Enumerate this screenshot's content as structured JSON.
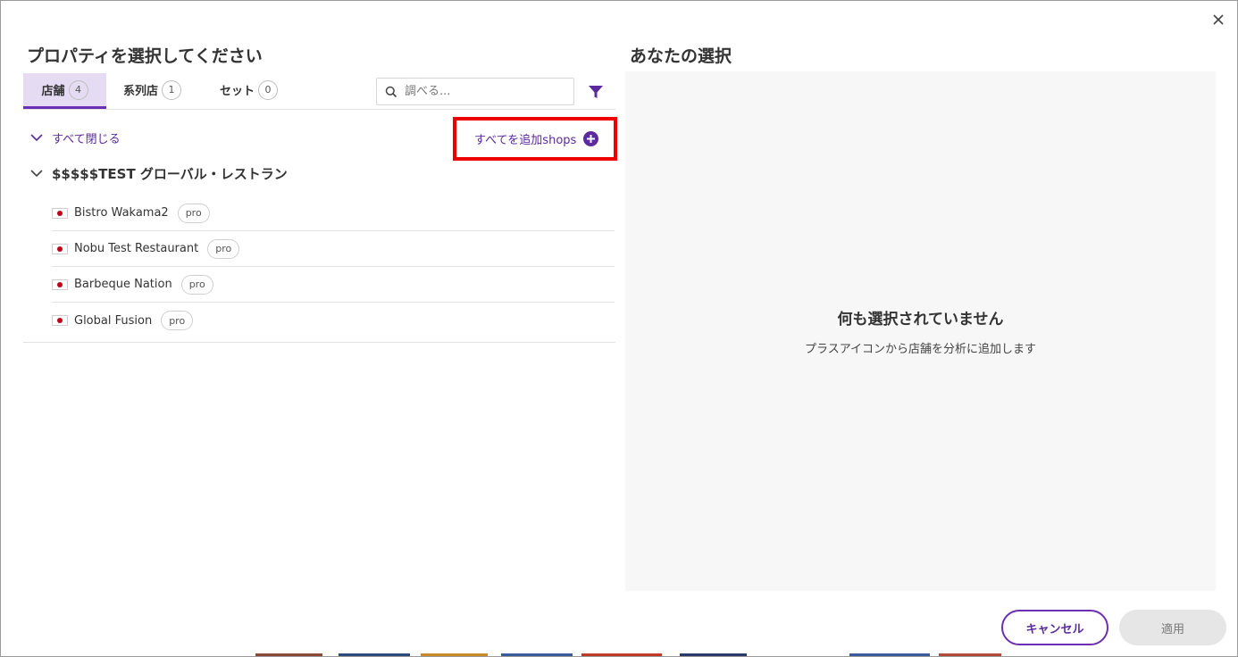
{
  "left": {
    "title": "プロパティを選択してください",
    "tabs": [
      {
        "label": "店舗",
        "count": "4",
        "active": true
      },
      {
        "label": "系列店",
        "count": "1",
        "active": false
      },
      {
        "label": "セット",
        "count": "0",
        "active": false
      }
    ],
    "search": {
      "placeholder": "調べる...",
      "value": ""
    },
    "collapse_all_label": "すべて閉じる",
    "add_all_label": "すべてを追加shops",
    "group": {
      "name": "$$$$$TEST グローバル・レストラン",
      "shops": [
        {
          "name": "Bistro Wakama2",
          "badge": "pro"
        },
        {
          "name": "Nobu Test Restaurant",
          "badge": "pro"
        },
        {
          "name": "Barbeque Nation",
          "badge": "pro"
        },
        {
          "name": "Global Fusion",
          "badge": "pro"
        }
      ]
    }
  },
  "right": {
    "title": "あなたの選択",
    "empty_title": "何も選択されていません",
    "empty_desc": "プラスアイコンから店舗を分析に追加します"
  },
  "footer": {
    "cancel_label": "キャンセル",
    "apply_label": "適用"
  },
  "icons": {
    "close": "close-icon",
    "search": "search-icon",
    "filter": "filter-icon",
    "chevron": "chevron-down-icon",
    "plus": "plus-circle-icon",
    "flag": "japan-flag-icon"
  },
  "colors": {
    "accent": "#6b2fb3",
    "accent_text": "#5a2a9e",
    "tab_active_bg": "#e5dcf3",
    "highlight_frame": "#ee0000",
    "panel_bg": "#f7f7f7",
    "apply_disabled_bg": "#e6e6e6"
  }
}
